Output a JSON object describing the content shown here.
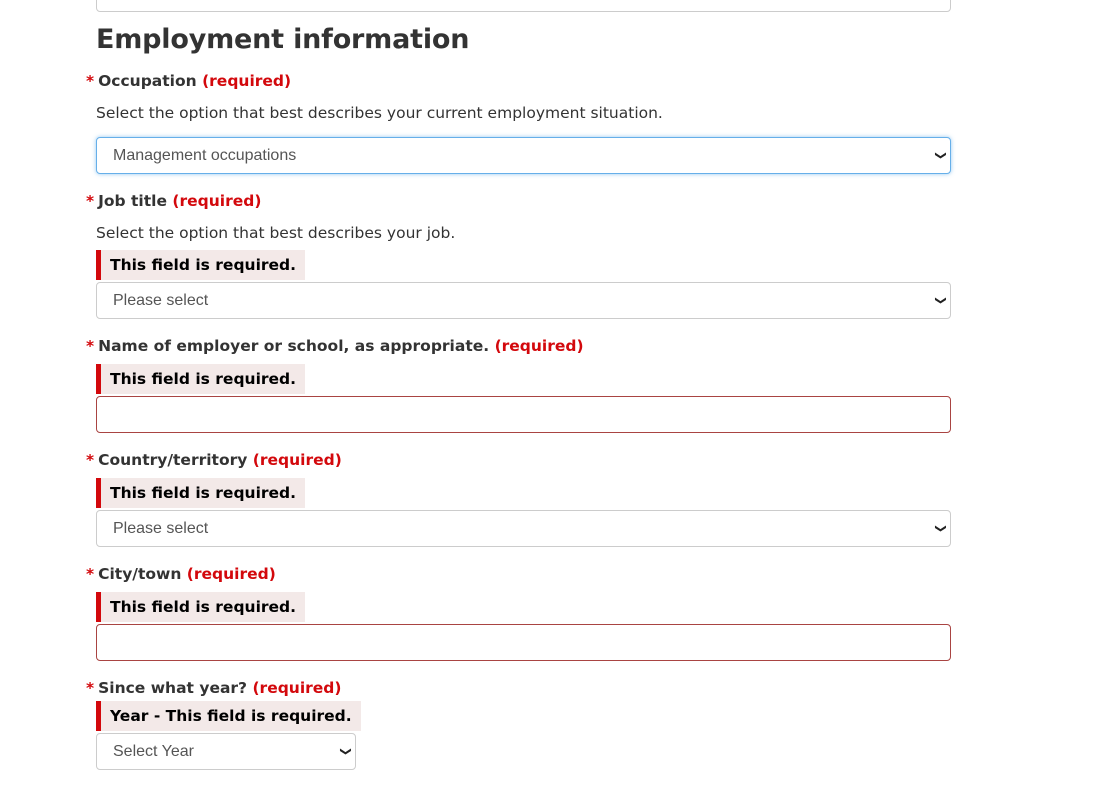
{
  "section_title": "Employment information",
  "required_marker": "*",
  "required_text": "(required)",
  "error_message": "This field is required.",
  "fields": {
    "occupation": {
      "label": "Occupation",
      "hint": "Select the option that best describes your current employment situation.",
      "value": "Management occupations"
    },
    "job_title": {
      "label": "Job title",
      "hint": "Select the option that best describes your job.",
      "value": "Please select"
    },
    "employer": {
      "label": "Name of employer or school, as appropriate.",
      "value": ""
    },
    "country": {
      "label": "Country/territory",
      "value": "Please select"
    },
    "city": {
      "label": "City/town",
      "value": ""
    },
    "since_year": {
      "label": "Since what year?",
      "error": "Year - This field is required.",
      "value": "Select Year"
    }
  },
  "icons": {
    "dropdown": "chevron-down-icon"
  },
  "colors": {
    "required": "#d3080c",
    "error_bg": "#f3e9e8",
    "focus": "#66afe9",
    "error_border": "#a94442"
  }
}
